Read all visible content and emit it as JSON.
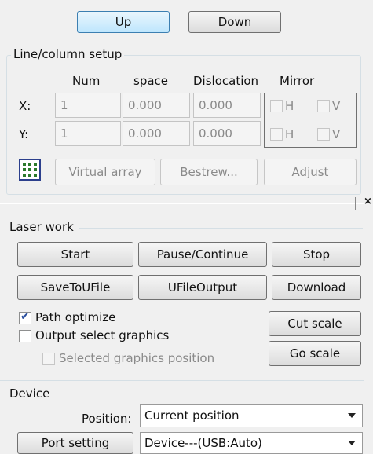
{
  "top_buttons": {
    "up": "Up",
    "down": "Down"
  },
  "line_column_setup": {
    "title": "Line/column setup",
    "headers": {
      "num": "Num",
      "space": "space",
      "dislocation": "Dislocation",
      "mirror": "Mirror"
    },
    "x": {
      "label": "X:",
      "num": "1",
      "space": "0.000",
      "dislocation": "0.000",
      "h": "H",
      "v": "V",
      "h_checked": false,
      "v_checked": false
    },
    "y": {
      "label": "Y:",
      "num": "1",
      "space": "0.000",
      "dislocation": "0.000",
      "h": "H",
      "v": "V",
      "h_checked": false,
      "v_checked": false
    },
    "buttons": {
      "virtual_array": "Virtual array",
      "bestrew": "Bestrew...",
      "adjust": "Adjust"
    },
    "grid_icon": "array-grid-icon"
  },
  "splitter": {
    "close_glyph": "×"
  },
  "laser_work": {
    "title": "Laser work",
    "buttons": {
      "start": "Start",
      "pause_continue": "Pause/Continue",
      "stop": "Stop",
      "save_to_ufile": "SaveToUFile",
      "ufile_output": "UFileOutput",
      "download": "Download",
      "cut_scale": "Cut scale",
      "go_scale": "Go scale"
    },
    "options": {
      "path_optimize": {
        "label": "Path optimize",
        "checked": true
      },
      "output_select_graphics": {
        "label": "Output select graphics",
        "checked": false
      },
      "selected_graphics_position": {
        "label": "Selected graphics position",
        "checked": false
      }
    }
  },
  "device": {
    "title": "Device",
    "position_label": "Position:",
    "position_value": "Current position",
    "port_setting": "Port setting",
    "device_value": "Device---(USB:Auto)"
  }
}
